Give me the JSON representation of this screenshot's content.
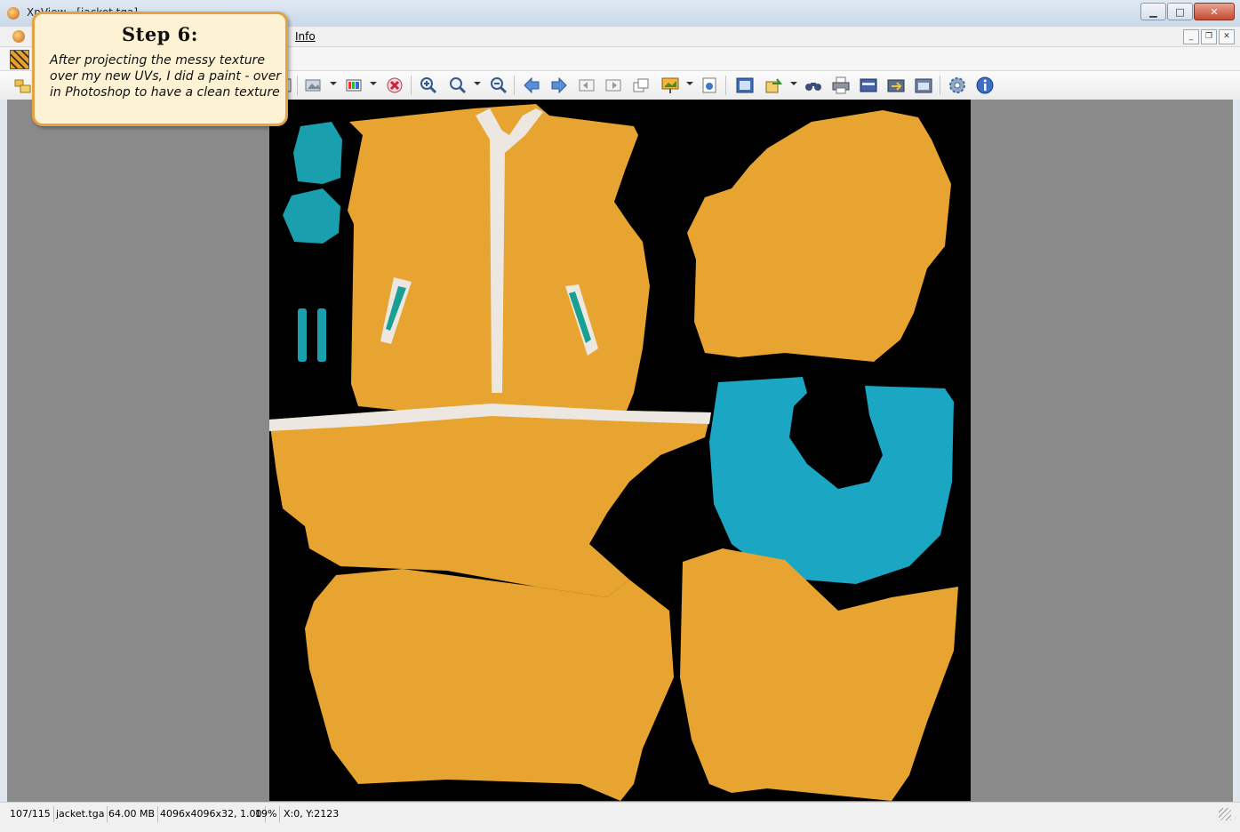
{
  "window": {
    "title": "XnView - [jacket.tga]",
    "controls": [
      "minimize",
      "maximize",
      "close"
    ]
  },
  "menubar": {
    "items": [
      "Info"
    ]
  },
  "callout": {
    "title": "Step 6:",
    "body": "After projecting the messy texture over my new UVs, I did a paint - over in Photoshop to have a clean texture"
  },
  "toolbar": {
    "icons": [
      "browser-icon",
      "open-icon",
      "save-icon",
      "adjust-color-icon",
      "delete-icon",
      "zoom-in-icon",
      "zoom-1to1-icon",
      "zoom-out-icon",
      "previous-icon",
      "next-icon",
      "first-icon",
      "last-icon",
      "multiple-pages-icon",
      "slideshow-icon",
      "properties-icon",
      "fullscreen-icon",
      "convert-icon",
      "find-icon",
      "print-icon",
      "scanner-icon",
      "batch-icon",
      "capture-icon",
      "settings-icon",
      "about-icon"
    ]
  },
  "image": {
    "filename": "jacket.tga",
    "colors": {
      "fabric": "#e8a430",
      "trim": "#e9e6df",
      "lining": "#1ba7c4",
      "pocket": "#1a9f93",
      "background": "#000000"
    }
  },
  "statusbar": {
    "index": "107/115",
    "filename": "jacket.tga",
    "size": "64.00 MB",
    "dimensions": "4096x4096x32, 1.00",
    "zoom": "19%",
    "coords": "X:0, Y:2123"
  }
}
